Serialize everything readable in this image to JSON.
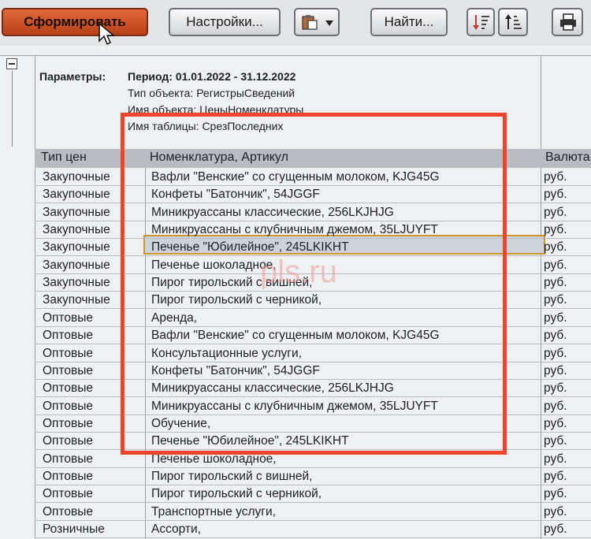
{
  "toolbar": {
    "generate_label": "Сформировать",
    "settings_label": "Настройки...",
    "find_label": "Найти..."
  },
  "params": {
    "label": "Параметры:",
    "period": "Период: 01.01.2022 - 31.12.2022",
    "object_type": "Тип объекта: РегистрыСведений",
    "object_name": "Имя объекта: ЦеныНоменклатуры",
    "table_name": "Имя таблицы: СрезПоследних"
  },
  "table": {
    "columns": [
      "Тип цен",
      "Номенклатура, Артикул",
      "Валюта"
    ],
    "rows": [
      {
        "type": "Закупочные",
        "nom": "Вафли \"Венские\" со сгущенным молоком, KJG45G",
        "cur": "руб."
      },
      {
        "type": "Закупочные",
        "nom": "Конфеты \"Батончик\", 54JGGF",
        "cur": "руб."
      },
      {
        "type": "Закупочные",
        "nom": "Миникруассаны классические, 256LKJHJG",
        "cur": "руб."
      },
      {
        "type": "Закупочные",
        "nom": "Миникруассаны с клубничным джемом, 35LJUYFT",
        "cur": "руб."
      },
      {
        "type": "Закупочные",
        "nom": "Печенье \"Юбилейное\", 245LKIKHT",
        "cur": "руб."
      },
      {
        "type": "Закупочные",
        "nom": "Печенье шоколадное,",
        "cur": "руб."
      },
      {
        "type": "Закупочные",
        "nom": "Пирог тирольский с вишней,",
        "cur": "руб."
      },
      {
        "type": "Закупочные",
        "nom": "Пирог тирольский с черникой,",
        "cur": "руб."
      },
      {
        "type": "Оптовые",
        "nom": "Аренда,",
        "cur": "руб."
      },
      {
        "type": "Оптовые",
        "nom": "Вафли \"Венские\" со сгущенным молоком, KJG45G",
        "cur": "руб."
      },
      {
        "type": "Оптовые",
        "nom": "Консультационные услуги,",
        "cur": "руб."
      },
      {
        "type": "Оптовые",
        "nom": "Конфеты \"Батончик\", 54JGGF",
        "cur": "руб."
      },
      {
        "type": "Оптовые",
        "nom": "Миникруассаны классические, 256LKJHJG",
        "cur": "руб."
      },
      {
        "type": "Оптовые",
        "nom": "Миникруассаны с клубничным джемом, 35LJUYFT",
        "cur": "руб."
      },
      {
        "type": "Оптовые",
        "nom": "Обучение,",
        "cur": "руб."
      },
      {
        "type": "Оптовые",
        "nom": "Печенье \"Юбилейное\", 245LKIKHT",
        "cur": "руб."
      },
      {
        "type": "Оптовые",
        "nom": "Печенье шоколадное,",
        "cur": "руб."
      },
      {
        "type": "Оптовые",
        "nom": "Пирог тирольский с вишней,",
        "cur": "руб."
      },
      {
        "type": "Оптовые",
        "nom": "Пирог тирольский с черникой,",
        "cur": "руб."
      },
      {
        "type": "Оптовые",
        "nom": "Транспортные услуги,",
        "cur": "руб."
      },
      {
        "type": "Розничные",
        "nom": "Ассорти,",
        "cur": "руб."
      }
    ]
  },
  "watermark": "pls.ru",
  "colors": {
    "generate_button": "#c4502a",
    "annotation_box": "#f0442a",
    "selected_row_border": "#c8962a",
    "header_bg": "#b9bdc3"
  }
}
